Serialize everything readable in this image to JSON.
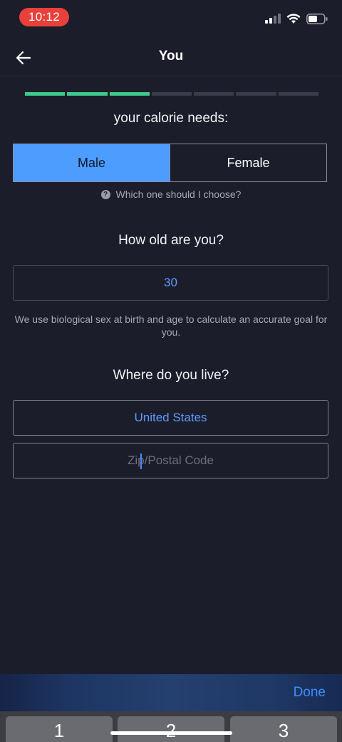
{
  "status_bar": {
    "time": "10:12",
    "icons": [
      "signal-icon",
      "wifi-icon",
      "battery-icon"
    ]
  },
  "header": {
    "title": "You",
    "back_icon": "arrow-left-icon"
  },
  "progress": {
    "total_steps": 7,
    "completed_steps": 3,
    "done_color": "#3ec98a"
  },
  "sex_section": {
    "heading": "your calorie needs:",
    "options": [
      {
        "label": "Male",
        "selected": true
      },
      {
        "label": "Female",
        "selected": false
      }
    ],
    "help_text": "Which one should I choose?"
  },
  "age_section": {
    "heading": "How old are you?",
    "value": "30",
    "note": "We use biological sex at birth and age to calculate an accurate goal for you."
  },
  "location_section": {
    "heading": "Where do you live?",
    "country": "United States",
    "zip_placeholder": "Zip/Postal Code"
  },
  "keyboard": {
    "done_label": "Done",
    "keys": [
      "1",
      "2",
      "3"
    ]
  },
  "colors": {
    "background": "#1c1d2b",
    "accent": "#4d9cff",
    "link": "#3d8dff"
  }
}
